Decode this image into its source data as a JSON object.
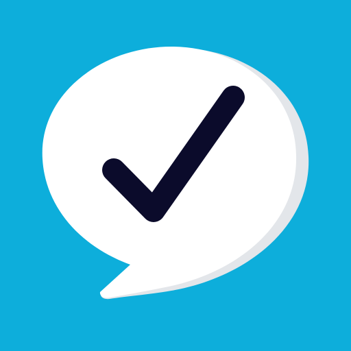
{
  "icon": {
    "name": "speech-bubble-checkmark-icon",
    "colors": {
      "background": "#0DAEDB",
      "bubble": "#FFFFFF",
      "bubble_shadow": "#E3E6EA",
      "checkmark": "#0B0B2B"
    }
  }
}
